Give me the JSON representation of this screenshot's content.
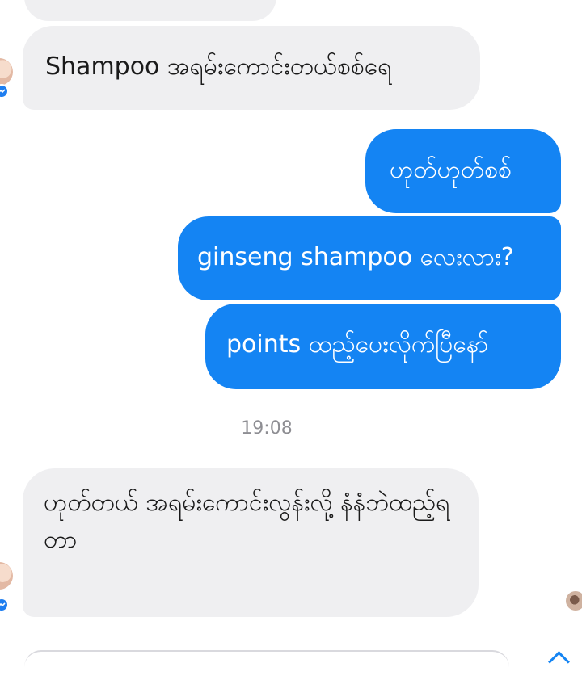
{
  "chat": {
    "messages": [
      {
        "sender": "contact",
        "text": "Shampoo အရမ်းကောင်းတယ်စစ်ရေ"
      },
      {
        "sender": "me",
        "text": "ဟုတ်ဟုတ်စစ်"
      },
      {
        "sender": "me",
        "text": "ginseng shampoo လေးလား?"
      },
      {
        "sender": "me",
        "text": "points ထည့်ပေးလိုက်ပြီနော်"
      },
      {
        "sender": "contact",
        "text": "ဟုတ်တယ် အရမ်းကောင်းလွန်းလို့ နံနံဘဲထည့်ရတာ"
      }
    ],
    "timestamp": "19:08"
  },
  "icons": {
    "contact_avatar": "contact-avatar-icon",
    "messenger_badge": "messenger-logo-icon",
    "read_receipt": "seen-avatar-icon"
  },
  "colors": {
    "outgoing_bubble": "#1484f3",
    "incoming_bubble": "#efeff1",
    "timestamp_text": "#8e8e93"
  }
}
